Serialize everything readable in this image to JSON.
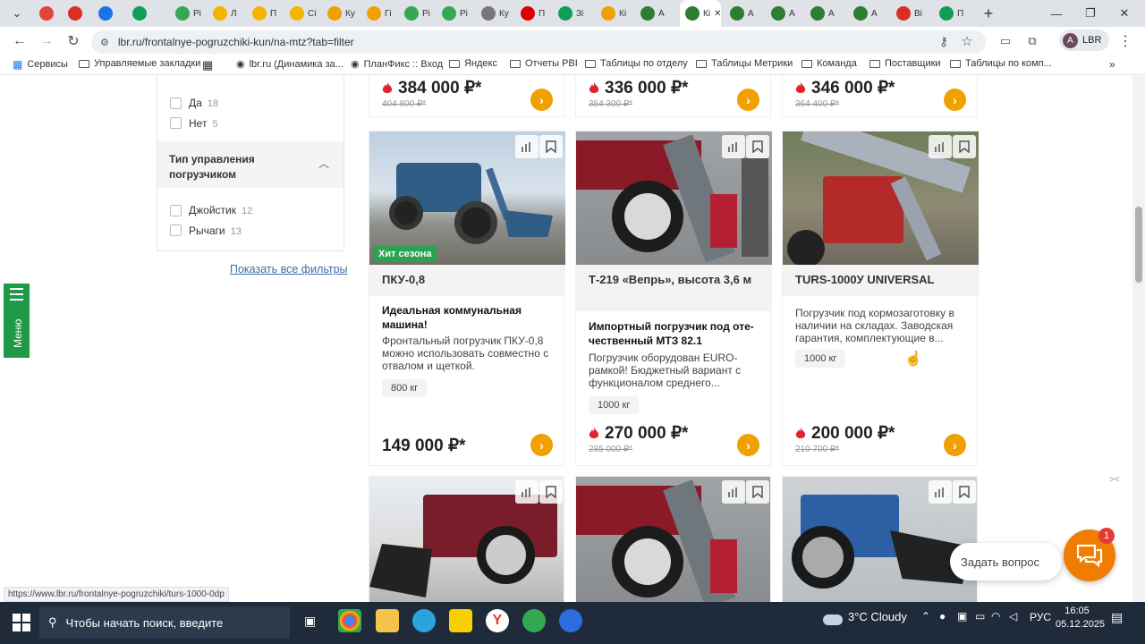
{
  "browser": {
    "tabs": [
      {
        "label": "",
        "color": "#e0453a"
      },
      {
        "label": "",
        "color": "#d93025"
      },
      {
        "label": "",
        "color": "#1a73e8"
      },
      {
        "label": "",
        "color": "#0f9d58"
      },
      {
        "label": "Рі",
        "color": "#34a853"
      },
      {
        "label": "Л",
        "color": "#f4b400"
      },
      {
        "label": "П",
        "color": "#f4b400"
      },
      {
        "label": "Сі",
        "color": "#f4b400"
      },
      {
        "label": "Ку",
        "color": "#f0a000"
      },
      {
        "label": "Гі",
        "color": "#f0a000"
      },
      {
        "label": "Рі",
        "color": "#34a853"
      },
      {
        "label": "Рі",
        "color": "#34a853"
      },
      {
        "label": "Ку",
        "color": "#777"
      },
      {
        "label": "П",
        "color": "#d00"
      },
      {
        "label": "Зі",
        "color": "#0f9d58"
      },
      {
        "label": "Кі",
        "color": "#f0a000"
      },
      {
        "label": "А",
        "color": "#2e7d32"
      },
      {
        "label": "Кі",
        "color": "#2e7d32"
      },
      {
        "label": "А",
        "color": "#2e7d32"
      },
      {
        "label": "А",
        "color": "#2e7d32"
      },
      {
        "label": "А",
        "color": "#2e7d32"
      },
      {
        "label": "А",
        "color": "#2e7d32"
      },
      {
        "label": "Ві",
        "color": "#d93025"
      },
      {
        "label": "П",
        "color": "#0f9d58"
      }
    ],
    "active_tab": "Кі",
    "url": "lbr.ru/frontalnye-pogruzchiki-kun/na-mtz?tab=filter",
    "profile": "LBR",
    "profile_initial": "A",
    "status_url": "https://www.lbr.ru/frontalnye-pogruzchiki/turs-1000-0dp"
  },
  "bookmarks": [
    {
      "label": "Сервисы",
      "icon": "apps-icon"
    },
    {
      "label": "Управляемые закладки",
      "icon": "folder-icon"
    },
    {
      "label": "",
      "icon": "grid-icon"
    },
    {
      "label": "lbr.ru (Динамика за...",
      "icon": "site-icon"
    },
    {
      "label": "ПланФикс :: Вход",
      "icon": "site-icon"
    },
    {
      "label": "Яндекс",
      "icon": "folder-icon"
    },
    {
      "label": "Отчеты PBI",
      "icon": "folder-icon"
    },
    {
      "label": "Таблицы по отделу",
      "icon": "folder-icon"
    },
    {
      "label": "Таблицы Метрики",
      "icon": "folder-icon"
    },
    {
      "label": "Команда",
      "icon": "folder-icon"
    },
    {
      "label": "Поставщики",
      "icon": "folder-icon"
    },
    {
      "label": "Таблицы по комп...",
      "icon": "folder-icon"
    }
  ],
  "filters": {
    "group1_options": [
      {
        "label": "Да",
        "count": "18"
      },
      {
        "label": "Нет",
        "count": "5"
      }
    ],
    "group2_title": "Тип управления погрузчиком",
    "group2_options": [
      {
        "label": "Джойстик",
        "count": "12"
      },
      {
        "label": "Рычаги",
        "count": "13"
      }
    ],
    "show_all": "Показать все фильтры"
  },
  "side_menu": "Меню",
  "top_prices": [
    {
      "price": "384 000 ₽*",
      "old": "404 800 ₽*"
    },
    {
      "price": "336 000 ₽*",
      "old": "354 300 ₽*"
    },
    {
      "price": "346 000 ₽*",
      "old": "364 400 ₽*"
    }
  ],
  "cards": [
    {
      "badge": "Хит сезона",
      "title": "ПКУ-0,8",
      "subtitle": "Идеальная коммунальная машина!",
      "desc": "Фронтальный погрузчик ПКУ-0,8 можно использовать совместно с отвалом и щеткой.",
      "capacity": "800 кг",
      "price": "149 000 ₽*",
      "old": ""
    },
    {
      "badge": "",
      "title": "Т-219 «Вепрь», высота 3,6 м",
      "subtitle": "Импортный погрузчик под оте-чественный МТЗ 82.1",
      "desc": "Погрузчик оборудован EURO-рамкой! Бюджетный вариант с функционалом среднего...",
      "capacity": "1000 кг",
      "price": "270 000 ₽*",
      "old": "285 000 ₽*"
    },
    {
      "badge": "",
      "title": "TURS-1000У UNIVERSAL",
      "subtitle": "",
      "desc": "Погрузчик под кормозаготовку в наличии на складах. Заводская гарантия, комплектующие в...",
      "capacity": "1000 кг",
      "price": "200 000 ₽*",
      "old": "210 700 ₽*"
    }
  ],
  "chat": {
    "label": "Задать вопрос",
    "badge": "1"
  },
  "taskbar": {
    "search_placeholder": "Чтобы начать поиск, введите",
    "weather": "3°C  Cloudy",
    "lang": "РУС",
    "time": "16:05",
    "date": "05.12.2025"
  }
}
